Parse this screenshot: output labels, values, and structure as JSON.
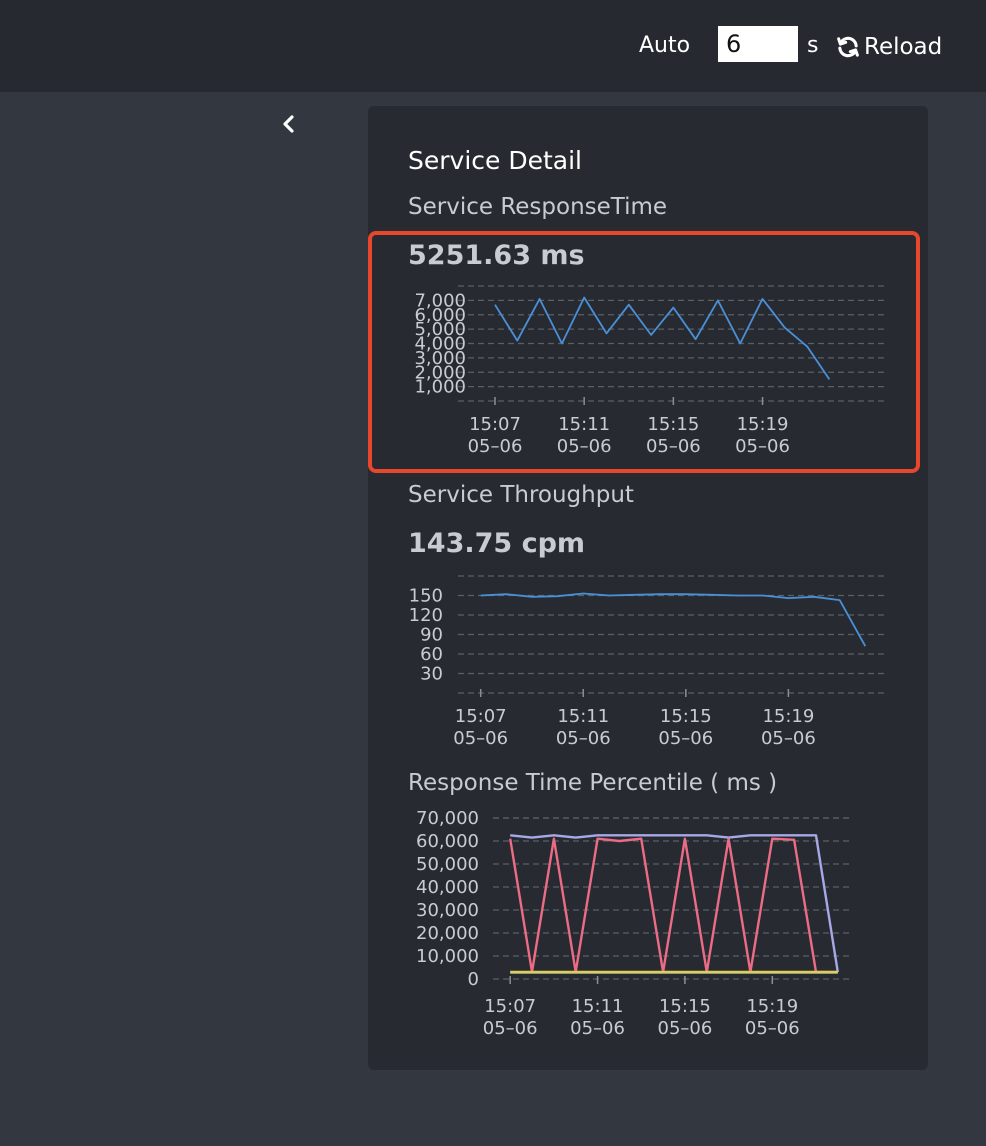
{
  "toolbar": {
    "auto_label": "Auto",
    "interval_value": "6",
    "unit_label": "s",
    "reload_label": "Reload"
  },
  "panel": {
    "title": "Service Detail",
    "response_time": {
      "title": "Service ResponseTime",
      "value": "5251.63 ms"
    },
    "throughput": {
      "title": "Service Throughput",
      "value": "143.75 cpm"
    },
    "percentile": {
      "title": "Response Time Percentile ( ms )"
    }
  },
  "colors": {
    "line_blue": "#4a90d9",
    "p_purple": "#a7a8e6",
    "p_pink": "#ec6b85",
    "p_yellow": "#e7c95a",
    "p_green": "#8fd18a",
    "highlight": "#e8472b"
  },
  "chart_data": [
    {
      "id": "response-time",
      "type": "line",
      "x_ticks": [
        "15:07\n05–06",
        "15:11\n05–06",
        "15:15\n05–06",
        "15:19\n05–06"
      ],
      "y_ticks": [
        "1,000",
        "2,000",
        "3,000",
        "4,000",
        "5,000",
        "6,000",
        "7,000"
      ],
      "ylim": [
        0,
        8000
      ],
      "xlim": [
        0,
        17
      ],
      "grid": true,
      "series": [
        {
          "x": [
            0,
            1,
            2,
            3,
            4,
            5,
            6,
            7,
            8,
            9,
            10,
            11,
            12,
            13,
            14,
            15
          ],
          "values": [
            6700,
            4200,
            7100,
            4000,
            7200,
            4700,
            6700,
            4600,
            6500,
            4300,
            7000,
            4000,
            7100,
            5100,
            3800,
            1500
          ]
        }
      ]
    },
    {
      "id": "throughput",
      "type": "line",
      "x_ticks": [
        "15:07\n05–06",
        "15:11\n05–06",
        "15:15\n05–06",
        "15:19\n05–06"
      ],
      "y_ticks": [
        "30",
        "60",
        "90",
        "120",
        "150"
      ],
      "ylim": [
        0,
        180
      ],
      "xlim": [
        -0.3,
        15.3
      ],
      "grid": true,
      "series": [
        {
          "x": [
            0,
            1,
            2,
            3,
            4,
            5,
            6,
            7,
            8,
            9,
            10,
            11,
            12,
            13,
            14,
            15
          ],
          "values": [
            150,
            152,
            148,
            149,
            153,
            150,
            151,
            152,
            152,
            151,
            150,
            150,
            146,
            148,
            143,
            72
          ]
        }
      ]
    },
    {
      "id": "percentile",
      "type": "line",
      "x_ticks": [
        "15:07\n05–06",
        "15:11\n05–06",
        "15:15\n05–06",
        "15:19\n05–06"
      ],
      "y_ticks": [
        "0",
        "10,000",
        "20,000",
        "30,000",
        "40,000",
        "50,000",
        "60,000",
        "70,000"
      ],
      "ylim": [
        0,
        70000
      ],
      "xlim": [
        -0.1,
        15.1
      ],
      "grid": true,
      "series": [
        {
          "color_key": "p_purple",
          "x": [
            0,
            1,
            2,
            3,
            4,
            5,
            6,
            7,
            8,
            9,
            10,
            11,
            12,
            13,
            14,
            15
          ],
          "values": [
            62500,
            61500,
            62500,
            61500,
            62500,
            62500,
            62500,
            62500,
            62500,
            62500,
            61500,
            62500,
            62500,
            62500,
            62500,
            3000
          ]
        },
        {
          "color_key": "p_pink",
          "x": [
            0,
            1,
            2,
            3,
            4,
            5,
            6,
            7,
            8,
            9,
            10,
            11,
            12,
            13,
            14,
            15
          ],
          "values": [
            61000,
            3000,
            61000,
            3000,
            61000,
            60000,
            61000,
            3000,
            61000,
            3000,
            61000,
            3000,
            61000,
            60500,
            3000,
            3000
          ]
        },
        {
          "color_key": "p_green",
          "x": [
            0,
            15
          ],
          "values": [
            2800,
            2800
          ]
        },
        {
          "color_key": "p_yellow",
          "x": [
            0,
            15
          ],
          "values": [
            3100,
            3100
          ]
        }
      ]
    }
  ]
}
